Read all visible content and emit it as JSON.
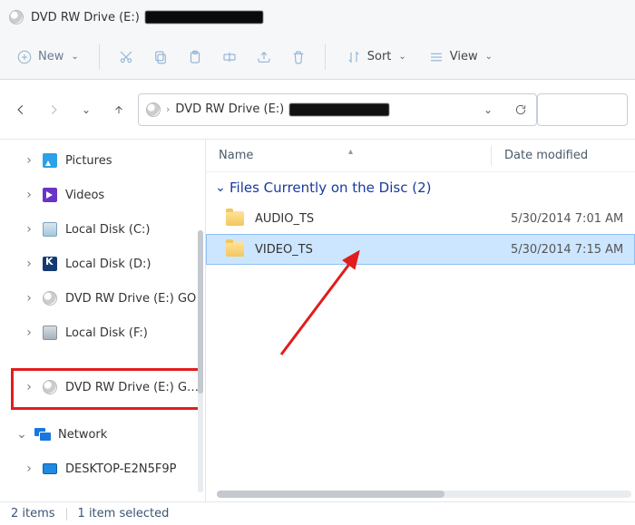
{
  "window": {
    "title": "DVD RW Drive (E:)"
  },
  "toolbar": {
    "new": "New",
    "sort": "Sort",
    "view": "View"
  },
  "address": {
    "crumb": "DVD RW Drive (E:)"
  },
  "tree": {
    "pictures": "Pictures",
    "videos": "Videos",
    "localC": "Local Disk (C:)",
    "localD": "Local Disk (D:)",
    "dvd1": "DVD RW Drive (E:) GO",
    "localF": "Local Disk (F:)",
    "dvd2": "DVD RW Drive (E:) GOD",
    "network": "Network",
    "desktop": "DESKTOP-E2N5F9P"
  },
  "columns": {
    "name": "Name",
    "date": "Date modified"
  },
  "group": {
    "label": "Files Currently on the Disc (2)"
  },
  "rows": {
    "audio": {
      "name": "AUDIO_TS",
      "date": "5/30/2014 7:01 AM"
    },
    "video": {
      "name": "VIDEO_TS",
      "date": "5/30/2014 7:15 AM"
    }
  },
  "status": {
    "items": "2 items",
    "selected": "1 item selected"
  }
}
